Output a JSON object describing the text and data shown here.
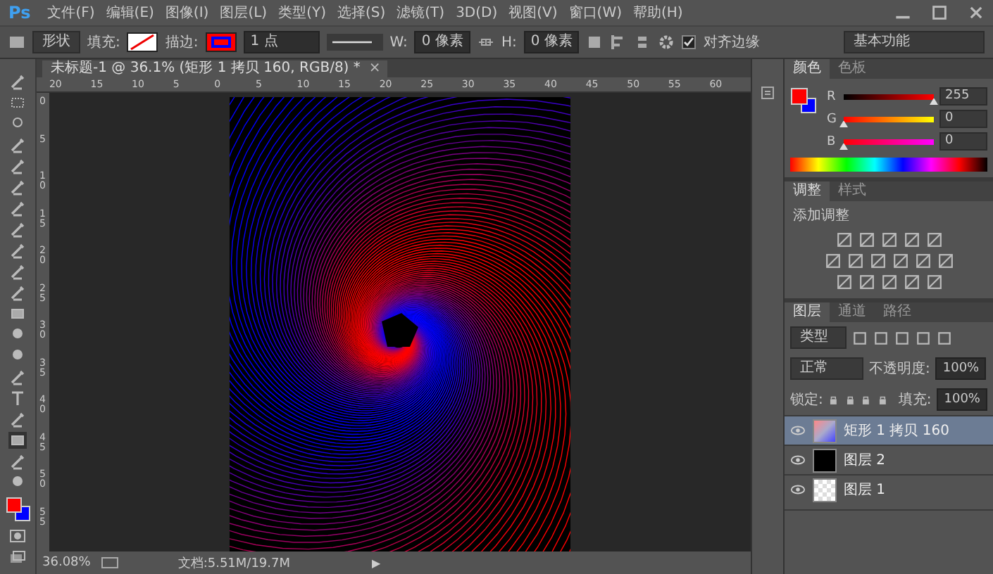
{
  "app_logo": "Ps",
  "menu": [
    "文件(F)",
    "编辑(E)",
    "图像(I)",
    "图层(L)",
    "类型(Y)",
    "选择(S)",
    "滤镜(T)",
    "3D(D)",
    "视图(V)",
    "窗口(W)",
    "帮助(H)"
  ],
  "options_bar": {
    "shape_mode": "形状",
    "fill_label": "填充:",
    "stroke_label": "描边:",
    "stroke_width": "1 点",
    "w_label": "W:",
    "w_value": "0 像素",
    "h_label": "H:",
    "h_value": "0 像素",
    "align_edges": {
      "label": "对齐边缘",
      "checked": true
    },
    "workspace": "基本功能"
  },
  "document_tab": {
    "title": "未标题-1 @ 36.1% (矩形 1 拷贝 160, RGB/8) *",
    "close": "×"
  },
  "ruler": {
    "horizontal": [
      "20",
      "15",
      "10",
      "5",
      "0",
      "5",
      "10",
      "15",
      "20",
      "25",
      "30",
      "35",
      "40",
      "45",
      "50",
      "55",
      "60"
    ],
    "vertical": [
      "0",
      "5",
      "10",
      "15",
      "20",
      "25",
      "30",
      "35",
      "40",
      "45",
      "50",
      "55"
    ]
  },
  "color_panel": {
    "tabs": [
      {
        "label": "颜色",
        "selected": true
      },
      {
        "label": "色板",
        "selected": false
      }
    ],
    "channels": [
      {
        "label": "R",
        "value": "255",
        "level": 1
      },
      {
        "label": "G",
        "value": "0",
        "level": 0
      },
      {
        "label": "B",
        "value": "0",
        "level": 0
      }
    ]
  },
  "adjustments_panel": {
    "tabs": [
      {
        "label": "调整",
        "selected": true
      },
      {
        "label": "样式",
        "selected": false
      }
    ],
    "heading": "添加调整"
  },
  "layers_panel": {
    "tabs": [
      {
        "label": "图层",
        "selected": true
      },
      {
        "label": "通道",
        "selected": false
      },
      {
        "label": "路径",
        "selected": false
      }
    ],
    "filter": "类型",
    "blend_mode": "正常",
    "opacity_label": "不透明度:",
    "opacity": "100%",
    "lock_label": "锁定:",
    "fill_label": "填充:",
    "fill": "100%",
    "layers": [
      {
        "name": "矩形 1 拷贝 160",
        "selected": true,
        "visible": true,
        "kind": "shape"
      },
      {
        "name": "图层 2",
        "selected": false,
        "visible": true,
        "kind": "black"
      },
      {
        "name": "图层 1",
        "selected": false,
        "visible": true,
        "kind": "transparent"
      }
    ]
  },
  "status_bar": {
    "zoom": "36.08%",
    "document": "文档:5.51M/19.7M",
    "arrow": "▶"
  }
}
